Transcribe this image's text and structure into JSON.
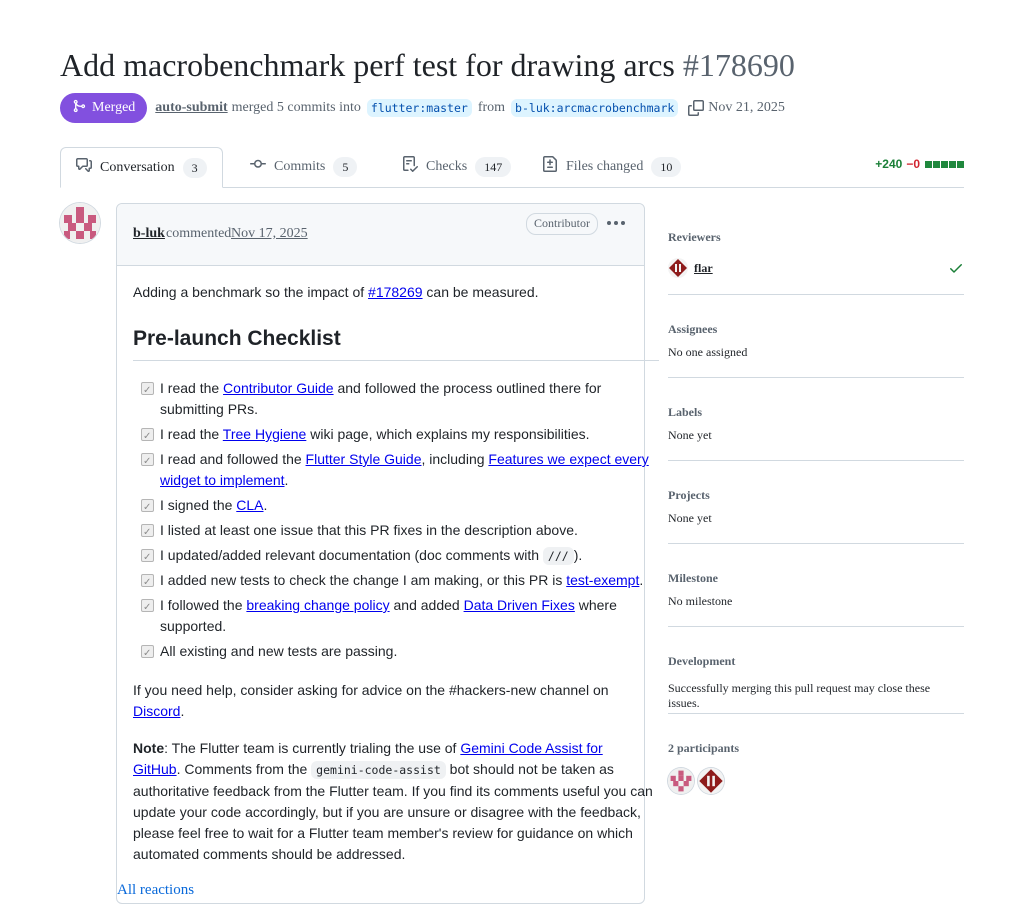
{
  "pr": {
    "title": "Add macrobenchmark perf test for drawing arcs",
    "number": "#178690",
    "state": "Merged",
    "author": "auto-submit",
    "merged_text": "merged 5 commits into",
    "base_branch": "flutter:master",
    "from_text": "from",
    "head_branch": "b-luk:arcmacrobenchmark",
    "date": "Nov 21, 2025"
  },
  "tabs": [
    {
      "label": "Conversation",
      "count": "3",
      "icon": "comment-discussion-icon"
    },
    {
      "label": "Commits",
      "count": "5",
      "icon": "git-commit-icon"
    },
    {
      "label": "Checks",
      "count": "147",
      "icon": "checklist-icon"
    },
    {
      "label": "Files changed",
      "count": "10",
      "icon": "file-diff-icon"
    }
  ],
  "diffstat": {
    "additions": "+240",
    "deletions": "−0"
  },
  "comment": {
    "author": "b-luk",
    "action": "commented",
    "date": "Nov 17, 2025",
    "role": "Contributor",
    "intro_prefix": "Adding a benchmark so the impact of ",
    "intro_link": "#178269",
    "intro_suffix": " can be measured.",
    "checklist_title": "Pre-launch Checklist",
    "checklist": [
      {
        "pre": "I read the ",
        "link": "Contributor Guide",
        "post": " and followed the process outlined there for submitting PRs."
      },
      {
        "pre": "I read the ",
        "link": "Tree Hygiene",
        "post": " wiki page, which explains my responsibilities."
      },
      {
        "pre": "I read and followed the ",
        "link": "Flutter Style Guide",
        "mid": ", including ",
        "link2": "Features we expect every widget to implement",
        "post": "."
      },
      {
        "pre": "I signed the ",
        "link": "CLA",
        "post": "."
      },
      {
        "pre": "I listed at least one issue that this PR fixes in the description above.",
        "link": "",
        "post": ""
      },
      {
        "pre": "I updated/added relevant documentation (doc comments with ",
        "code": "///",
        "post": ")."
      },
      {
        "pre": "I added new tests to check the change I am making, or this PR is ",
        "link": "test-exempt",
        "post": "."
      },
      {
        "pre": "I followed the ",
        "link": "breaking change policy",
        "mid": " and added ",
        "link2": "Data Driven Fixes",
        "post": " where supported."
      },
      {
        "pre": "All existing and new tests are passing.",
        "link": "",
        "post": ""
      }
    ],
    "help_prefix": "If you need help, consider asking for advice on the #hackers-new channel on ",
    "help_link": "Discord",
    "help_suffix": ".",
    "note_label": "Note",
    "note_prefix": ": The Flutter team is currently trialing the use of ",
    "note_link": "Gemini Code Assist for GitHub",
    "note_mid": ". Comments from the ",
    "note_code": "gemini-code-assist",
    "note_suffix": " bot should not be taken as authoritative feedback from the Flutter team. If you find its comments useful you can update your code accordingly, but if you are unsure or disagree with the feedback, please feel free to wait for a Flutter team member's review for guidance on which automated comments should be addressed.",
    "reactions": "All reactions"
  },
  "sidebar": {
    "reviewers_title": "Reviewers",
    "reviewer": "flar",
    "assignees_title": "Assignees",
    "assignees_value": "No one assigned",
    "labels_title": "Labels",
    "labels_value": "None yet",
    "projects_title": "Projects",
    "projects_value": "None yet",
    "milestone_title": "Milestone",
    "milestone_value": "No milestone",
    "development_title": "Development",
    "development_value": "Successfully merging this pull request may close these issues.",
    "participants_title": "2 participants"
  },
  "colors": {
    "merged": "#8250df",
    "addition": "#1a7f37",
    "deletion": "#d1242f",
    "link": "#0000ee"
  }
}
